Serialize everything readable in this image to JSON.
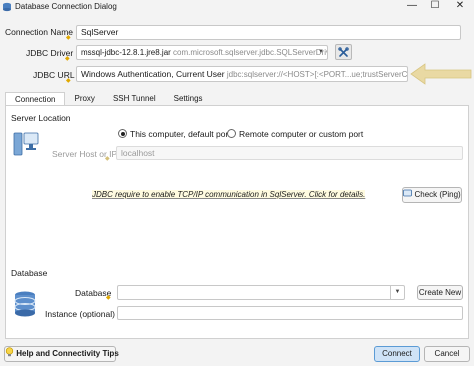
{
  "window": {
    "title": "Database Connection Dialog",
    "minimize": "—",
    "maximize": "☐",
    "close": "✕"
  },
  "form": {
    "connection_name_label": "Connection Name",
    "connection_name_value": "SqlServer",
    "jdbc_driver_label": "JDBC Driver",
    "jdbc_driver_main": "mssql-jdbc-12.8.1.jre8.jar",
    "jdbc_driver_class": "com.microsoft.sqlserver.jdbc.SQLServerDriver",
    "jdbc_url_label": "JDBC URL",
    "jdbc_url_main": "Windows Authentication, Current User",
    "jdbc_url_template": "jdbc:sqlserver://<HOST>[:<PORT...ue;trustServerCertificate=tru"
  },
  "tabs": [
    {
      "label": "Connection",
      "active": true
    },
    {
      "label": "Proxy",
      "active": false
    },
    {
      "label": "SSH Tunnel",
      "active": false
    },
    {
      "label": "Settings",
      "active": false
    }
  ],
  "server": {
    "section_title": "Server Location",
    "option_local": "This computer, default port",
    "option_remote": "Remote computer or custom port",
    "host_label": "Server Host or IP",
    "host_placeholder": "localhost"
  },
  "hint": {
    "text": "JDBC require to enable TCP/IP communication in SqlServer. Click for details.",
    "check_button": "Check (Ping)"
  },
  "database": {
    "section_title": "Database",
    "database_label": "Database",
    "database_value": "",
    "create_button": "Create New",
    "instance_label": "Instance (optional)",
    "instance_value": ""
  },
  "footer": {
    "help_button": "Help and Connectivity Tips",
    "connect_button": "Connect",
    "cancel_button": "Cancel"
  },
  "colors": {
    "accent": "#5b9bd5",
    "arrow": "#e9d9a3",
    "required_marker": "#e0a800"
  }
}
